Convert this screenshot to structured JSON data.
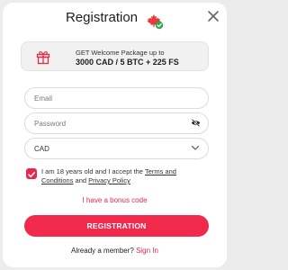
{
  "modal": {
    "title": "Registration"
  },
  "promo": {
    "line1": "GET Welcome Package up to",
    "line2": "3000 CAD / 5 BTC + 225 FS"
  },
  "form": {
    "email_placeholder": "Email",
    "password_placeholder": "Password",
    "currency_value": "CAD"
  },
  "terms": {
    "prefix": "I am 18 years old and I accept the",
    "terms_link": "Terms and Conditions",
    "and": "and",
    "privacy_link": "Privacy Policy"
  },
  "bonus_link": "I have a bonus code",
  "register_button": "REGISTRATION",
  "footer": {
    "prompt": "Already a member?",
    "signin_link": "Sign In"
  },
  "colors": {
    "accent": "#f1294a",
    "link_red": "#e6284b",
    "verified_green": "#2aa84a"
  },
  "icons": {
    "flag": "canada-flag-icon",
    "verified": "check-badge-icon",
    "close": "close-icon",
    "gift": "gift-icon",
    "eye": "eye-slash-icon",
    "chevron": "chevron-down-icon"
  }
}
